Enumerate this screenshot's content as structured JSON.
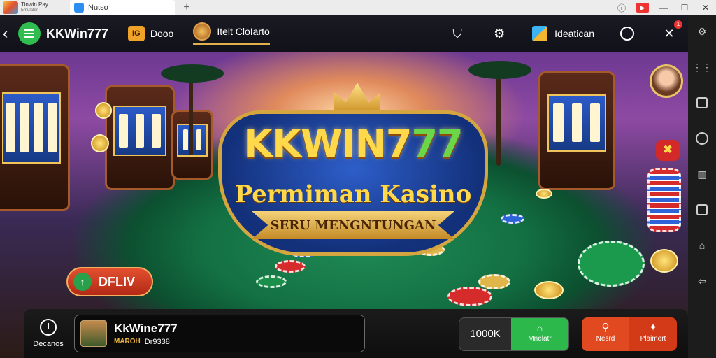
{
  "titlebar": {
    "app_name": "Tinwin Pay",
    "app_sub": "Emulator",
    "tab_label": "Nutso"
  },
  "header": {
    "brand": "KKWin777",
    "nav": [
      {
        "label": "Dooo",
        "icon": "IG"
      },
      {
        "label": "Itelt CloIarto"
      }
    ],
    "user_label": "Ideatican",
    "badge": "1"
  },
  "logo": {
    "title_a": "KKWIN7",
    "title_b": "77",
    "subtitle": "Permiman Kasino",
    "ribbon": "SERU MENGNTUNGAN"
  },
  "play_button": {
    "label": "DFLIV",
    "icon": "↑"
  },
  "bottom": {
    "history_label": "Decanos",
    "player_name": "KkWine777",
    "player_tag": "MAROH",
    "player_id": "Dr9338",
    "balance": "1000K",
    "deposit_label": "Mnelatr",
    "action1_label": "Nesrd",
    "action2_label": "Plaimert"
  },
  "icons": {
    "menu": "menu-icon",
    "back": "back-icon",
    "settings": "gear-icon",
    "close": "close-icon"
  },
  "colors": {
    "accent": "#2ebd4e",
    "gold": "#ffd94a",
    "action": "#e14a20"
  }
}
